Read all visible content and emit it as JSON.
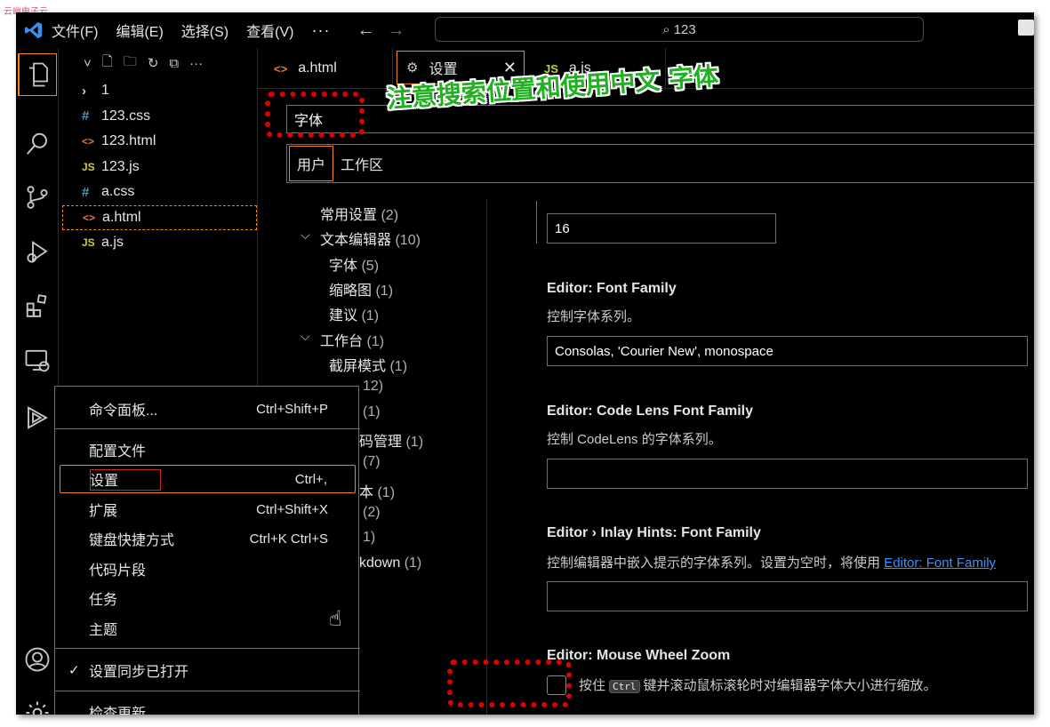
{
  "watermark": "云幽电子云...",
  "titlebar": {
    "menus": [
      "文件(F)",
      "编辑(E)",
      "选择(S)",
      "查看(V)"
    ],
    "more": "···",
    "search_text": "123"
  },
  "explorer": {
    "files": [
      {
        "icon": "folder-chevron",
        "glyph": "›",
        "name": "1"
      },
      {
        "icon": "css-icon",
        "glyph": "#",
        "name": "123.css"
      },
      {
        "icon": "html-icon",
        "glyph": "<>",
        "name": "123.html"
      },
      {
        "icon": "js-icon",
        "glyph": "JS",
        "name": "123.js"
      },
      {
        "icon": "css-icon",
        "glyph": "#",
        "name": "a.css"
      },
      {
        "icon": "html-icon",
        "glyph": "<>",
        "name": "a.html"
      },
      {
        "icon": "js-icon",
        "glyph": "JS",
        "name": "a.js"
      }
    ]
  },
  "tabs": [
    {
      "icon": "<>",
      "label": "a.html"
    },
    {
      "icon": "⚙",
      "label": "设置"
    },
    {
      "icon": "JS",
      "label": "a.js"
    }
  ],
  "settings": {
    "search_value": "字体",
    "scopes": [
      "用户",
      "工作区"
    ],
    "toc": {
      "common": "常用设置",
      "common_count": "(2)",
      "text_editor": "文本编辑器",
      "text_editor_count": "(10)",
      "font": "字体",
      "font_count": "(5)",
      "minimap": "缩略图",
      "minimap_count": "(1)",
      "suggest": "建议",
      "suggest_count": "(1)",
      "workbench": "工作台",
      "workbench_count": "(1)",
      "screencast": "截屏模式",
      "screencast_count": "(1)",
      "partial_1": "12)",
      "partial_2": "(1)",
      "partial_3": "码管理",
      "partial_3_count": "(1)",
      "partial_4": "(7)",
      "partial_5": "本",
      "partial_5_count": "(1)",
      "partial_6": "(2)",
      "partial_7": "1)",
      "partial_8": "kdown",
      "partial_8_count": "(1)"
    },
    "items": {
      "font_size_value": "16",
      "font_family_title": "Editor: Font Family",
      "font_family_desc": "控制字体系列。",
      "font_family_value": "Consolas, 'Courier New', monospace",
      "codelens_title": "Editor: Code Lens Font Family",
      "codelens_desc": "控制 CodeLens 的字体系列。",
      "inlay_title": "Editor › Inlay Hints: Font Family",
      "inlay_desc": "控制编辑器中嵌入提示的字体系列。设置为空时，将使用",
      "inlay_link": "Editor: Font Family",
      "wheel_title": "Editor: Mouse Wheel Zoom",
      "wheel_desc_pre": "按住",
      "wheel_kbd": "Ctrl",
      "wheel_desc_post": "键并滚动鼠标滚轮时对编辑器字体大小进行缩放。"
    }
  },
  "context_menu": {
    "command_palette": "命令面板...",
    "command_palette_key": "Ctrl+Shift+P",
    "profiles": "配置文件",
    "settings": "设置",
    "settings_key": "Ctrl+,",
    "extensions": "扩展",
    "extensions_key": "Ctrl+Shift+X",
    "keybindings": "键盘快捷方式",
    "keybindings_key": "Ctrl+K Ctrl+S",
    "snippets": "代码片段",
    "tasks": "任务",
    "themes": "主题",
    "sync": "设置同步已打开",
    "check_updates": "检查更新..."
  },
  "annotation": {
    "text": "注意搜索位置和使用中文    字体",
    "color": "#20b020"
  },
  "colors": {
    "focus_border": "#f38518",
    "background": "#000000",
    "annotation_red": "#e00000",
    "link": "#3794ff"
  }
}
